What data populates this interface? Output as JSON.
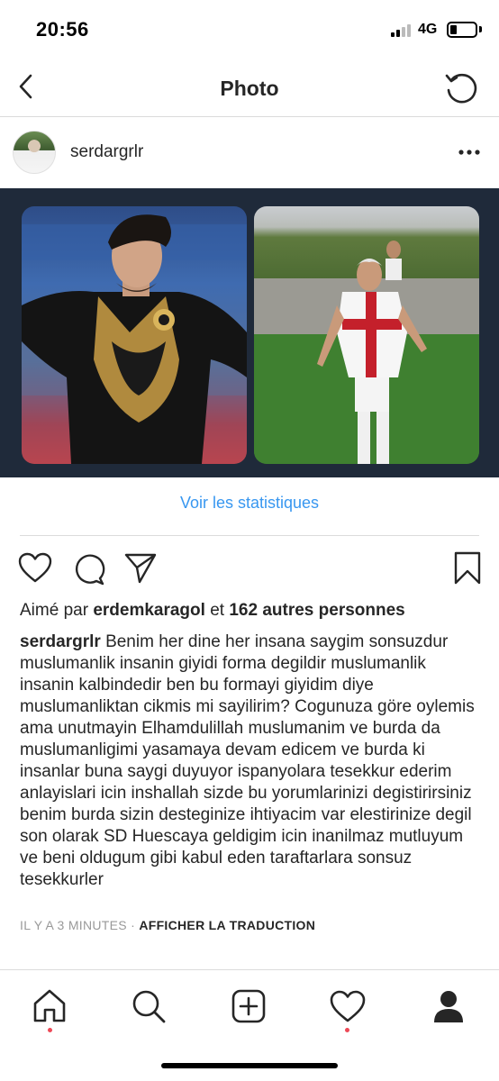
{
  "status_bar": {
    "time": "20:56",
    "network": "4G",
    "battery_level": 0.25
  },
  "nav": {
    "title": "Photo",
    "back_icon": "chevron-left-icon",
    "refresh_icon": "refresh-icon"
  },
  "post": {
    "username": "serdargrlr",
    "more_icon": "more-horizontal-icon",
    "stats_link": "Voir les statistiques",
    "likes": {
      "prefix": "Aimé par",
      "liked_by": "erdemkaragol",
      "conjunction": "et",
      "others": "162 autres personnes"
    },
    "caption": {
      "username": "serdargrlr",
      "text": "Benim her dine her insana saygim sonsuzdur muslumanlik insanin giyidi forma degildir muslumanlik insanin kalbindedir ben bu formayi giyidim diye muslumanliktan cikmis mi sayilirim? Cogunuza göre oylemis ama unutmayin Elhamdulillah muslumanim ve burda da muslumanligimi yasamaya devam edicem ve burda ki insanlar buna saygi duyuyor ispanyolara tesekkur ederim anlayislari icin inshallah sizde bu yorumlarinizi degistirirsiniz benim burda sizin desteginize ihtiyacim var elestirinize degil son olarak SD Huescaya geldigim icin inanilmaz mutluyum ve beni oldugum gibi kabul eden taraftarlara sonsuz tesekkurler"
    },
    "timestamp": "IL Y A 3 MINUTES",
    "separator": "·",
    "translate_label": "AFFICHER LA TRADUCTION"
  },
  "tab_bar": {
    "items": [
      "home-icon",
      "search-icon",
      "new-post-icon",
      "activity-icon",
      "profile-icon"
    ]
  },
  "colors": {
    "link": "#3897f0",
    "text": "#262626",
    "muted": "#999999",
    "notification_dot": "#ed4956"
  }
}
